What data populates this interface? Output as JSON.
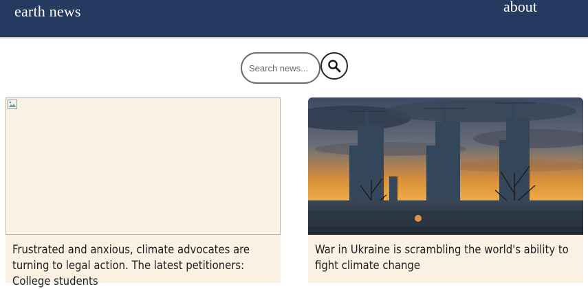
{
  "header": {
    "brand": "earth news",
    "nav_about": "about"
  },
  "search": {
    "placeholder": "Search news...",
    "value": "",
    "button_icon": "search-icon"
  },
  "articles": [
    {
      "title": "Frustrated and anxious, climate advocates are turning to legal action. The latest petitioners: College students",
      "image": "broken-image-icon"
    },
    {
      "title": "War in Ukraine is scrambling the world's ability to fight climate change",
      "image": "industrial-towers-sunset-photo"
    }
  ],
  "colors": {
    "header_bg": "#253a60",
    "card_bg": "#fbf1e3",
    "text": "#1d1d1d"
  }
}
